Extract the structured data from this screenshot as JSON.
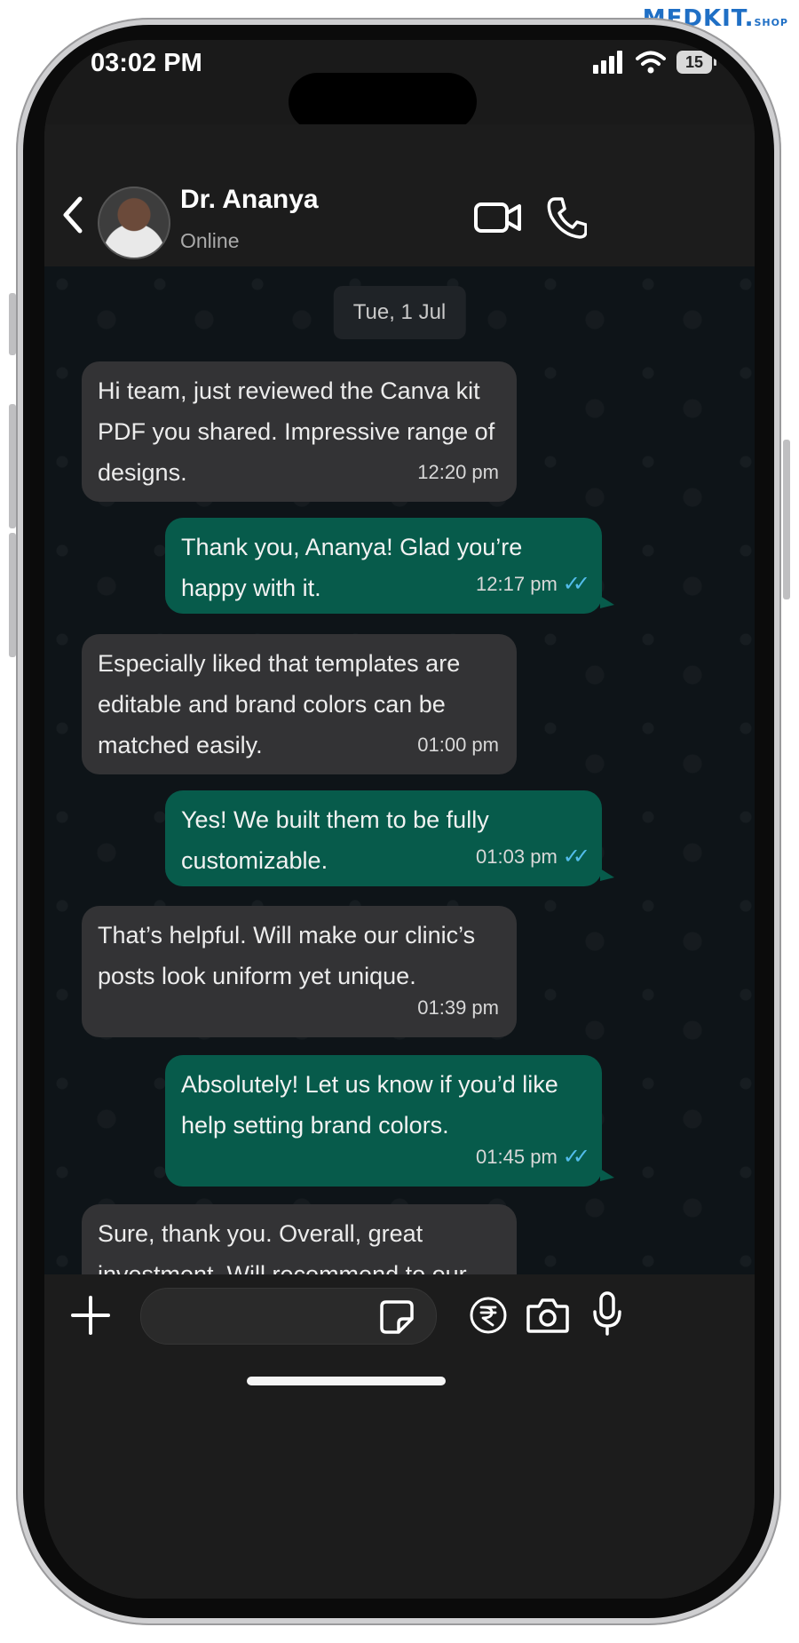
{
  "brand": {
    "name": "MEDKIT.",
    "suffix": "SHOP"
  },
  "status_bar": {
    "time": "03:02 PM",
    "battery": "15"
  },
  "header": {
    "contact_name": "Dr. Ananya",
    "contact_status": "Online"
  },
  "chat": {
    "date": "Tue, 1 Jul",
    "messages": [
      {
        "direction": "in",
        "text": "Hi team, just reviewed the Canva kit PDF you shared. Impressive range of designs.",
        "time": "12:20 pm"
      },
      {
        "direction": "out",
        "text": "Thank you, Ananya! Glad you’re happy with it.",
        "time": "12:17 pm"
      },
      {
        "direction": "in",
        "text": "Especially liked that templates are editable and brand colors can be matched easily.",
        "time": "01:00 pm"
      },
      {
        "direction": "out",
        "text": "Yes! We built them to be fully customizable.",
        "time": "01:03 pm"
      },
      {
        "direction": "in",
        "text": "That’s helpful. Will make our clinic’s posts look uniform yet unique.",
        "time": "01:39 pm"
      },
      {
        "direction": "out",
        "text": "Absolutely! Let us know if you’d like help setting brand colors.",
        "time": "01:45 pm"
      },
      {
        "direction": "in",
        "text": "Sure, thank you. Overall, great investment. Will recommend to our",
        "time": ""
      }
    ]
  },
  "icons": {
    "back": "chevron-left-icon",
    "video": "video-camera-icon",
    "call": "phone-icon",
    "attach": "plus-icon",
    "sticker": "sticker-icon",
    "payment": "rupee-icon",
    "camera": "camera-icon",
    "mic": "microphone-icon"
  },
  "colors": {
    "incoming": "#333335",
    "outgoing": "#075b4b",
    "read_ticks": "#53bdeb"
  }
}
